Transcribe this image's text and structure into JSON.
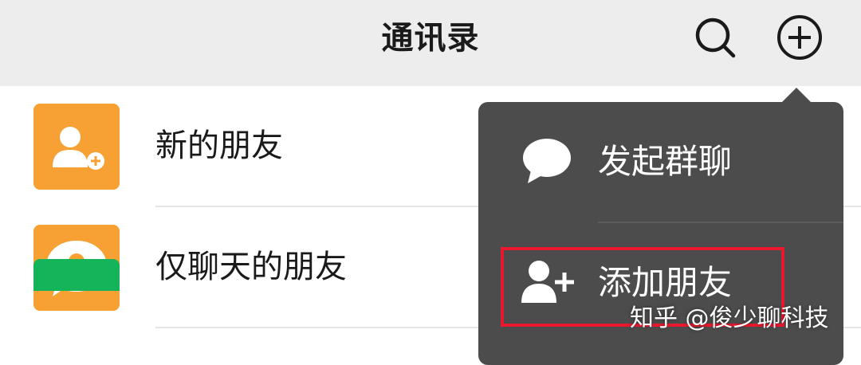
{
  "header": {
    "title": "通讯录",
    "search_icon": "search-icon",
    "add_icon": "plus-circle-icon"
  },
  "contacts": {
    "items": [
      {
        "label": "新的朋友",
        "icon": "add-user-icon",
        "color": "#f7a034"
      },
      {
        "label": "仅聊天的朋友",
        "icon": "chat-user-icon",
        "color": "#f7a034"
      }
    ],
    "partial_item_color": "#16b45a"
  },
  "popup_menu": {
    "items": [
      {
        "label": "发起群聊",
        "icon": "chat-bubble-icon"
      },
      {
        "label": "添加朋友",
        "icon": "add-user-icon"
      }
    ],
    "background": "#4c4c4c",
    "highlight_color": "#e8192e"
  },
  "watermark": "知乎 @俊少聊科技"
}
